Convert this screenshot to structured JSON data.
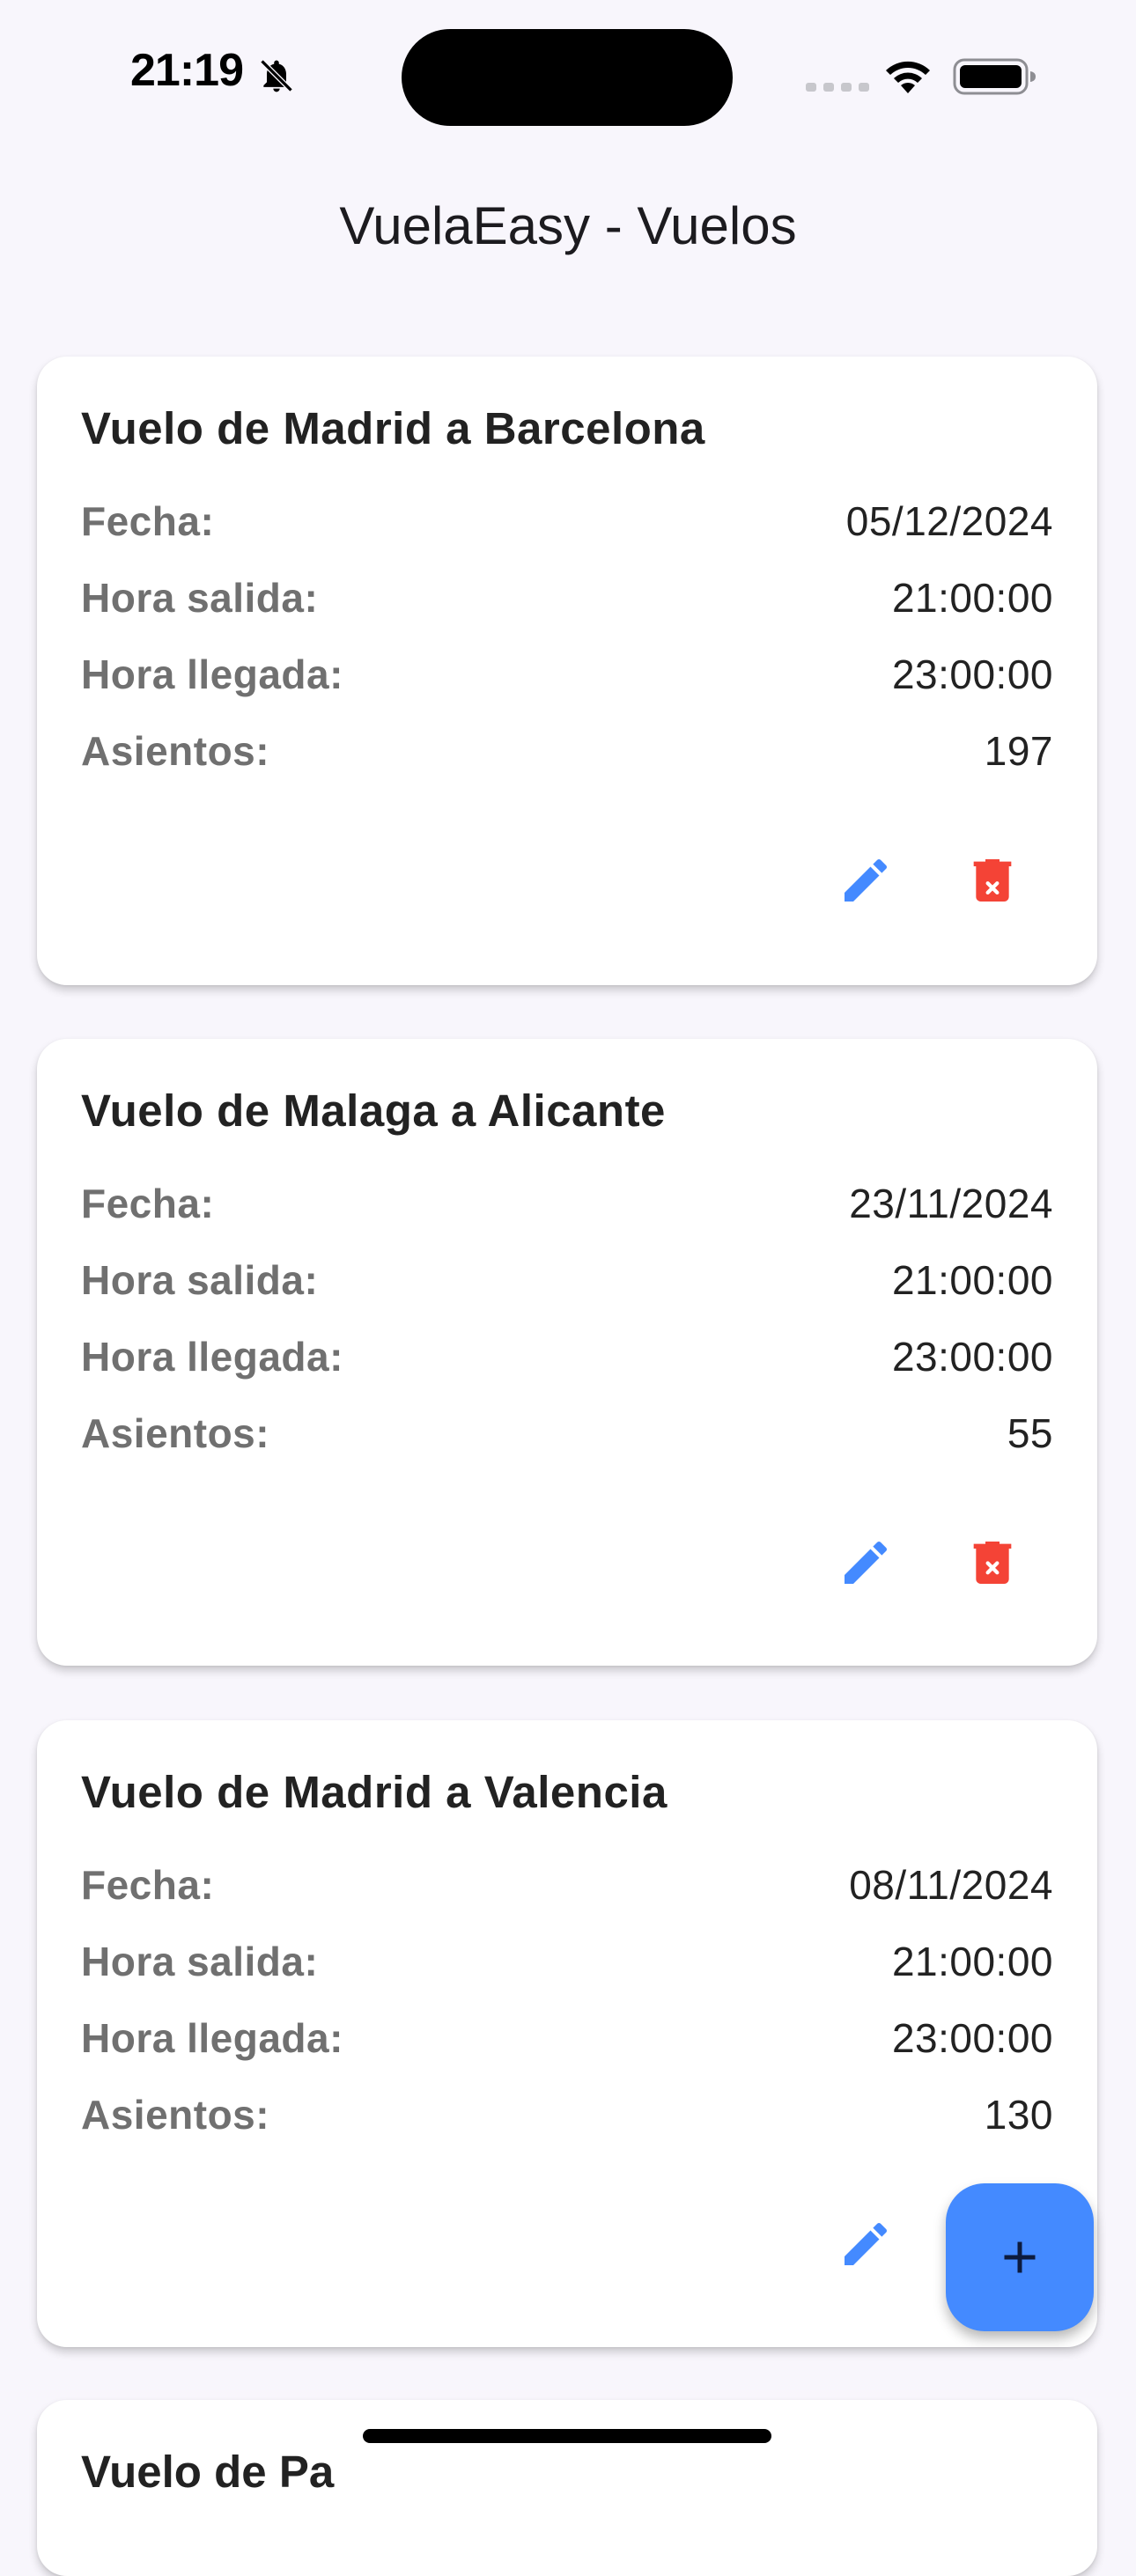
{
  "status_bar": {
    "time": "21:19",
    "icons": [
      "bell-slash-icon",
      "signal-icon",
      "wifi-icon",
      "battery-icon"
    ]
  },
  "app_bar": {
    "title": "VuelaEasy - Vuelos"
  },
  "labels": {
    "date": "Fecha:",
    "departure": "Hora salida:",
    "arrival": "Hora llegada:",
    "seats": "Asientos:"
  },
  "flights": [
    {
      "title": "Vuelo de Madrid a Barcelona",
      "date": "05/12/2024",
      "departure": "21:00:00",
      "arrival": "23:00:00",
      "seats": "197"
    },
    {
      "title": "Vuelo de Malaga a Alicante",
      "date": "23/11/2024",
      "departure": "21:00:00",
      "arrival": "23:00:00",
      "seats": "55"
    },
    {
      "title": "Vuelo de Madrid a Valencia",
      "date": "08/11/2024",
      "departure": "21:00:00",
      "arrival": "23:00:00",
      "seats": "130"
    }
  ],
  "partial_card_title": "Vuelo de Pa",
  "actions": {
    "edit_icon": "edit-icon",
    "delete_icon": "delete-icon",
    "add_icon": "add-icon"
  },
  "colors": {
    "background": "#f8f6fc",
    "card": "#ffffff",
    "edit": "#448aff",
    "delete": "#f44336",
    "fab": "#448aff",
    "fab_icon": "#0d1b3e",
    "label": "#707070"
  }
}
